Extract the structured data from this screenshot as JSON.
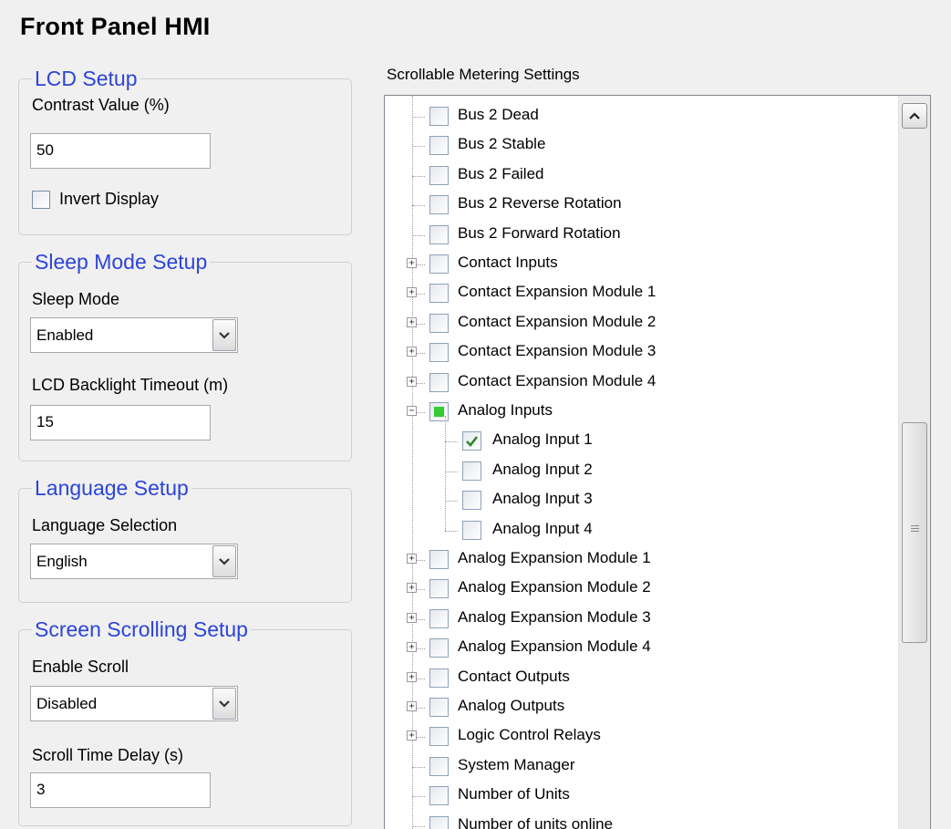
{
  "page_title": "Front Panel HMI",
  "lcd_setup": {
    "legend": "LCD Setup",
    "contrast_label": "Contrast Value (%)",
    "contrast_value": "50",
    "invert_label": "Invert Display",
    "invert_checked": false
  },
  "sleep_setup": {
    "legend": "Sleep Mode Setup",
    "sleep_mode_label": "Sleep Mode",
    "sleep_mode_value": "Enabled",
    "backlight_label": "LCD Backlight Timeout (m)",
    "backlight_value": "15"
  },
  "language_setup": {
    "legend": "Language Setup",
    "selection_label": "Language Selection",
    "selection_value": "English"
  },
  "scroll_setup": {
    "legend": "Screen Scrolling Setup",
    "enable_label": "Enable Scroll",
    "enable_value": "Disabled",
    "delay_label": "Scroll Time Delay (s)",
    "delay_value": "3"
  },
  "metering": {
    "title": "Scrollable Metering Settings",
    "items": [
      {
        "label": "Bus 2 Dead",
        "level": 0,
        "expander": "none",
        "state": "unchecked"
      },
      {
        "label": "Bus 2 Stable",
        "level": 0,
        "expander": "none",
        "state": "unchecked"
      },
      {
        "label": "Bus 2 Failed",
        "level": 0,
        "expander": "none",
        "state": "unchecked"
      },
      {
        "label": "Bus 2 Reverse Rotation",
        "level": 0,
        "expander": "none",
        "state": "unchecked"
      },
      {
        "label": "Bus 2 Forward Rotation",
        "level": 0,
        "expander": "none",
        "state": "unchecked"
      },
      {
        "label": "Contact Inputs",
        "level": 0,
        "expander": "collapsed",
        "state": "unchecked"
      },
      {
        "label": "Contact Expansion Module 1",
        "level": 0,
        "expander": "collapsed",
        "state": "unchecked"
      },
      {
        "label": "Contact Expansion Module 2",
        "level": 0,
        "expander": "collapsed",
        "state": "unchecked"
      },
      {
        "label": "Contact Expansion Module 3",
        "level": 0,
        "expander": "collapsed",
        "state": "unchecked"
      },
      {
        "label": "Contact Expansion Module 4",
        "level": 0,
        "expander": "collapsed",
        "state": "unchecked"
      },
      {
        "label": "Analog Inputs",
        "level": 0,
        "expander": "expanded",
        "state": "indeterminate"
      },
      {
        "label": "Analog Input 1",
        "level": 1,
        "expander": "none",
        "state": "checked"
      },
      {
        "label": "Analog Input 2",
        "level": 1,
        "expander": "none",
        "state": "unchecked"
      },
      {
        "label": "Analog Input 3",
        "level": 1,
        "expander": "none",
        "state": "unchecked"
      },
      {
        "label": "Analog Input 4",
        "level": 1,
        "expander": "none",
        "state": "unchecked"
      },
      {
        "label": "Analog Expansion Module 1",
        "level": 0,
        "expander": "collapsed",
        "state": "unchecked"
      },
      {
        "label": "Analog Expansion Module 2",
        "level": 0,
        "expander": "collapsed",
        "state": "unchecked"
      },
      {
        "label": "Analog Expansion Module 3",
        "level": 0,
        "expander": "collapsed",
        "state": "unchecked"
      },
      {
        "label": "Analog Expansion Module 4",
        "level": 0,
        "expander": "collapsed",
        "state": "unchecked"
      },
      {
        "label": "Contact Outputs",
        "level": 0,
        "expander": "collapsed",
        "state": "unchecked"
      },
      {
        "label": "Analog Outputs",
        "level": 0,
        "expander": "collapsed",
        "state": "unchecked"
      },
      {
        "label": "Logic Control Relays",
        "level": 0,
        "expander": "collapsed",
        "state": "unchecked"
      },
      {
        "label": "System Manager",
        "level": 0,
        "expander": "none",
        "state": "unchecked"
      },
      {
        "label": "Number of Units",
        "level": 0,
        "expander": "none",
        "state": "unchecked"
      },
      {
        "label": "Number of units online",
        "level": 0,
        "expander": "none",
        "state": "unchecked"
      }
    ]
  },
  "colors": {
    "legend_text": "#2c44d8",
    "indeterminate_fill": "#33cc33",
    "check_mark": "#2a8a2a"
  },
  "icons": {
    "combo_arrow": "chevron-down-icon",
    "scroll_up": "chevron-up-icon",
    "expand": "plus-icon",
    "collapse": "minus-icon",
    "check": "check-icon"
  }
}
